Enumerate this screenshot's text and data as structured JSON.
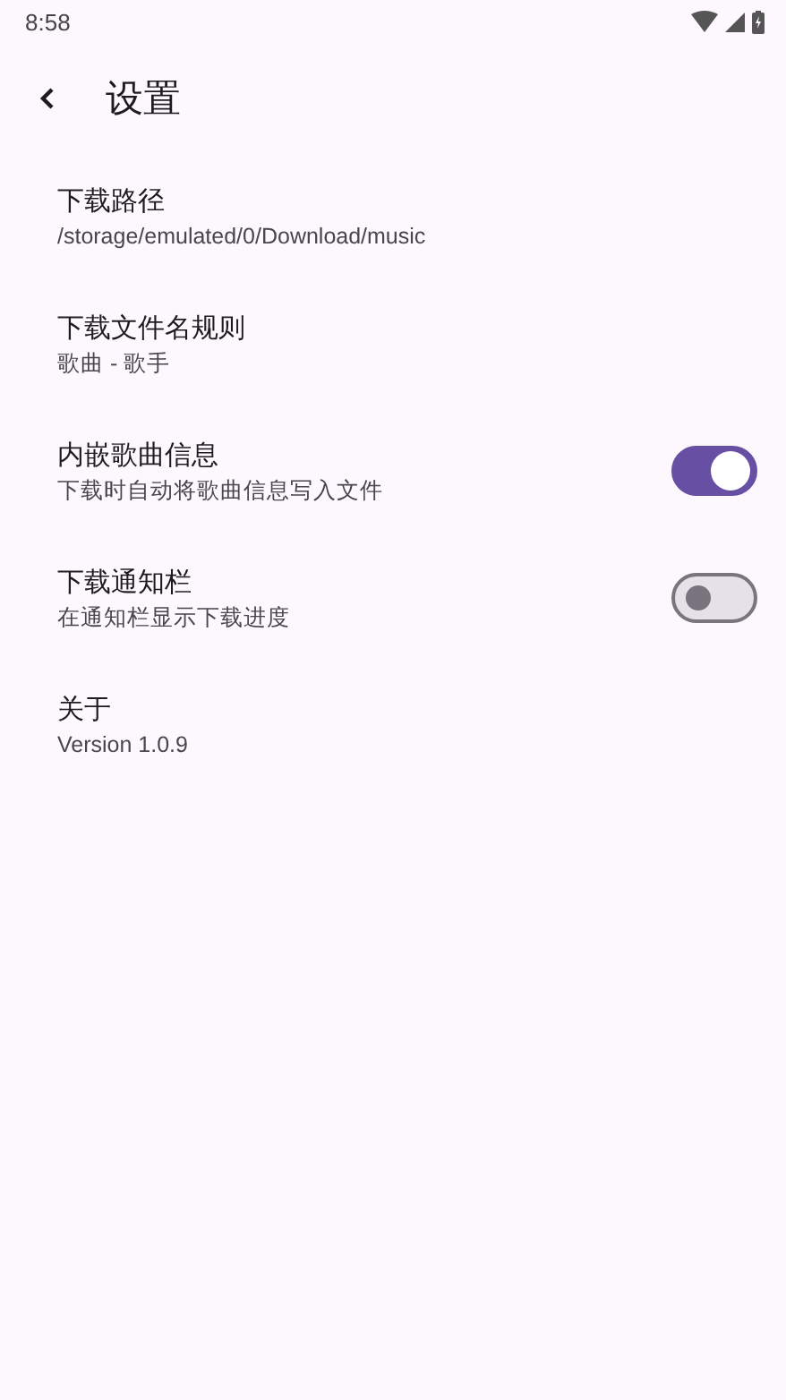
{
  "status_bar": {
    "time": "8:58"
  },
  "app_bar": {
    "title": "设置"
  },
  "settings": [
    {
      "kind": "text",
      "title": "下载路径",
      "subtitle": "/storage/emulated/0/Download/music"
    },
    {
      "kind": "text",
      "title": "下载文件名规则",
      "subtitle": "歌曲 - 歌手"
    },
    {
      "kind": "switch",
      "title": "内嵌歌曲信息",
      "subtitle": "下载时自动将歌曲信息写入文件",
      "on": true
    },
    {
      "kind": "switch",
      "title": "下载通知栏",
      "subtitle": "在通知栏显示下载进度",
      "on": false
    },
    {
      "kind": "text",
      "title": "关于",
      "subtitle": "Version 1.0.9"
    }
  ]
}
